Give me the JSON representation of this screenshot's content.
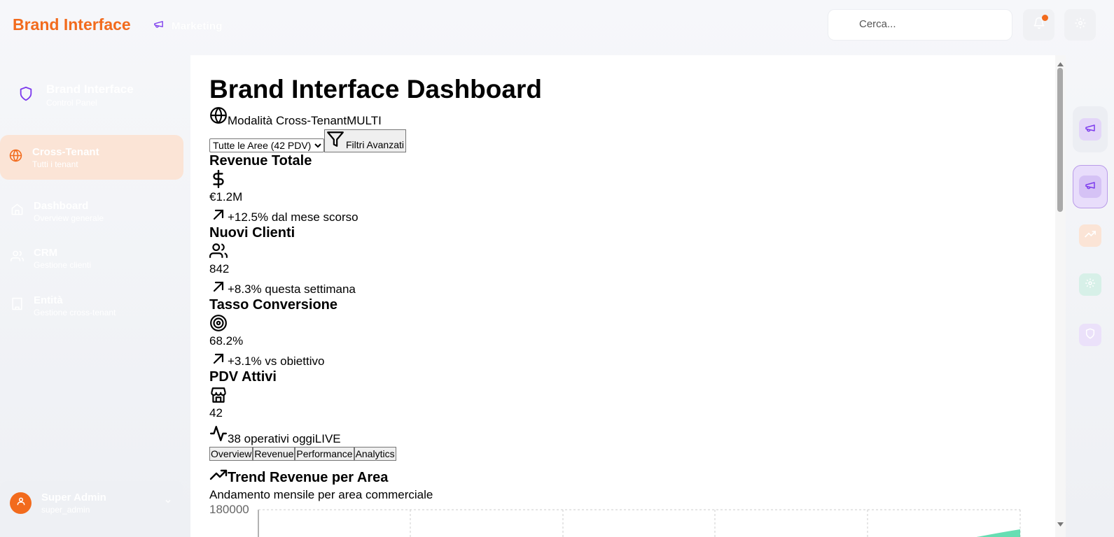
{
  "topbar": {
    "brand": "Brand Interface",
    "module_label": "Marketing",
    "search_placeholder": "Cerca..."
  },
  "sidebar": {
    "brand_title": "Brand Interface",
    "brand_subtitle": "Control Panel",
    "items": [
      {
        "label": "Cross-Tenant",
        "sub": "Tutti i tenant",
        "icon": "globe-icon",
        "active": true
      },
      {
        "label": "Dashboard",
        "sub": "Overview generale",
        "icon": "home-icon",
        "active": false
      },
      {
        "label": "CRM",
        "sub": "Gestione clienti",
        "icon": "users-icon",
        "active": false
      },
      {
        "label": "Entità",
        "sub": "Gestione cross-tenant",
        "icon": "building-icon",
        "active": false
      }
    ],
    "user": {
      "name": "Super Admin",
      "role": "super_admin"
    }
  },
  "main": {
    "title": "Brand Interface Dashboard",
    "mode_label": "Modalità Cross-Tenant",
    "mode_badge": "MULTI",
    "area_select": "Tutte le Aree (42 PDV)",
    "filters_button": "Filtri Avanzati",
    "kpis": [
      {
        "title": "Revenue Totale",
        "icon": "dollar-icon",
        "value": "€1.2M",
        "change_icon": "arrow-up-right-icon",
        "change": "+12.5% dal mese scorso"
      },
      {
        "title": "Nuovi Clienti",
        "icon": "users-icon",
        "value": "842",
        "change_icon": "arrow-up-right-icon",
        "change": "+8.3% questa settimana"
      },
      {
        "title": "Tasso Conversione",
        "icon": "target-icon",
        "value": "68.2%",
        "change_icon": "arrow-up-right-icon",
        "change": "+3.1% vs obiettivo"
      },
      {
        "title": "PDV Attivi",
        "icon": "store-icon",
        "value": "42",
        "change_icon": "activity-icon",
        "change": "38 operativi oggi",
        "badge": "LIVE"
      }
    ],
    "tabs": [
      "Overview",
      "Revenue",
      "Performance",
      "Analytics"
    ],
    "chart": {
      "title": "Trend Revenue per Area",
      "subtitle": "Andamento mensile per area commerciale",
      "y_top_tick": "180000"
    }
  },
  "colors": {
    "brand": "#f26b1d",
    "purple": "#7c3aed",
    "active_bg": "#fbe4d6",
    "chart_green": "#34d399"
  }
}
